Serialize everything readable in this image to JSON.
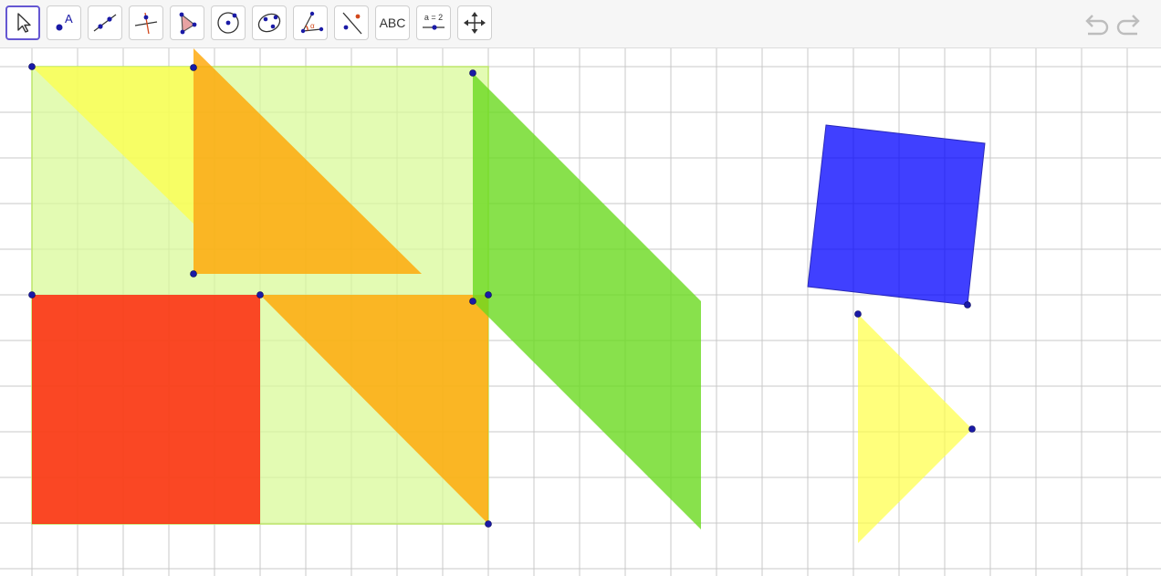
{
  "toolbar": {
    "tools": [
      {
        "name": "move-tool",
        "icon": "cursor-arrow-icon",
        "active": true
      },
      {
        "name": "point-tool",
        "icon": "point-icon",
        "label": "A"
      },
      {
        "name": "line-tool",
        "icon": "line-icon"
      },
      {
        "name": "perpendicular-line-tool",
        "icon": "perpendicular-icon"
      },
      {
        "name": "polygon-tool",
        "icon": "polygon-icon"
      },
      {
        "name": "circle-tool",
        "icon": "circle-center-point-icon"
      },
      {
        "name": "ellipse-tool",
        "icon": "ellipse-icon"
      },
      {
        "name": "angle-tool",
        "icon": "angle-icon",
        "label": "α"
      },
      {
        "name": "reflect-tool",
        "icon": "reflect-about-line-icon"
      },
      {
        "name": "text-tool",
        "icon": "text-icon",
        "label": "ABC"
      },
      {
        "name": "slider-tool",
        "icon": "slider-icon",
        "label": "a = 2"
      },
      {
        "name": "move-graphics-view-tool",
        "icon": "move-arrows-icon"
      }
    ],
    "undo_icon": "undo-icon",
    "redo_icon": "redo-icon"
  },
  "colors": {
    "square_fill": "#d9f99a",
    "red_square": "#ff1a00",
    "orange": "#ffa500",
    "yellow": "#ffff44",
    "green": "#6ad91f",
    "blue": "#0000ff",
    "grid": "#c8c8c8",
    "point": "#1a1aa6"
  }
}
